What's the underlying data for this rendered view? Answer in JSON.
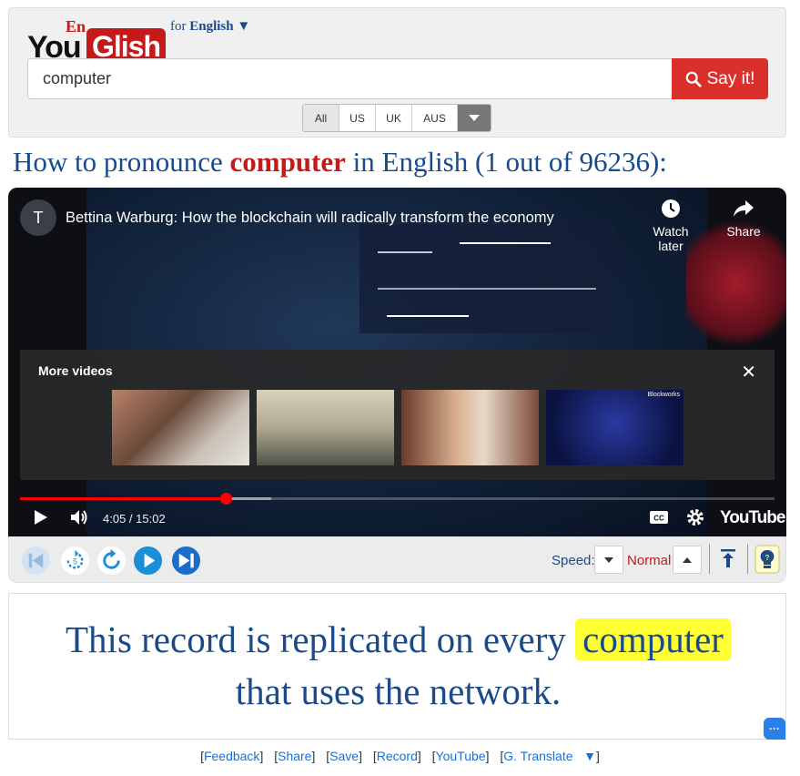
{
  "header": {
    "logo": {
      "en": "En",
      "you": "You",
      "glish": "Glish"
    },
    "for_label": "for",
    "language": "English ▼",
    "search_value": "computer",
    "say_button": "Say it!",
    "accents": [
      "All",
      "US",
      "UK",
      "AUS"
    ]
  },
  "title": {
    "prefix": "How to pronounce",
    "keyword": "computer",
    "suffix": "in English (1 out of 96236):"
  },
  "video": {
    "channel_initial": "T",
    "title": "Bettina Warburg: How the blockchain will radically transform the economy",
    "watch_later": "Watch later",
    "share": "Share",
    "more_videos": "More videos",
    "time": "4:05 / 15:02",
    "progress": 0.273,
    "brand": "YouTube",
    "thumb_label": "Blockworks"
  },
  "controls": {
    "speed_label": "Speed:",
    "speed_value": "Normal"
  },
  "caption": {
    "before": "This record is replicated on every",
    "keyword": "computer",
    "after": "that uses the network."
  },
  "links": [
    "Feedback",
    "Share",
    "Save",
    "Record",
    "YouTube",
    "G. Translate"
  ],
  "translate_arrow": "▼",
  "colors": {
    "brand_red": "#c51a1a",
    "link_blue": "#1a4a8a",
    "highlight": "#ffff33",
    "say_button": "#d9302c"
  }
}
